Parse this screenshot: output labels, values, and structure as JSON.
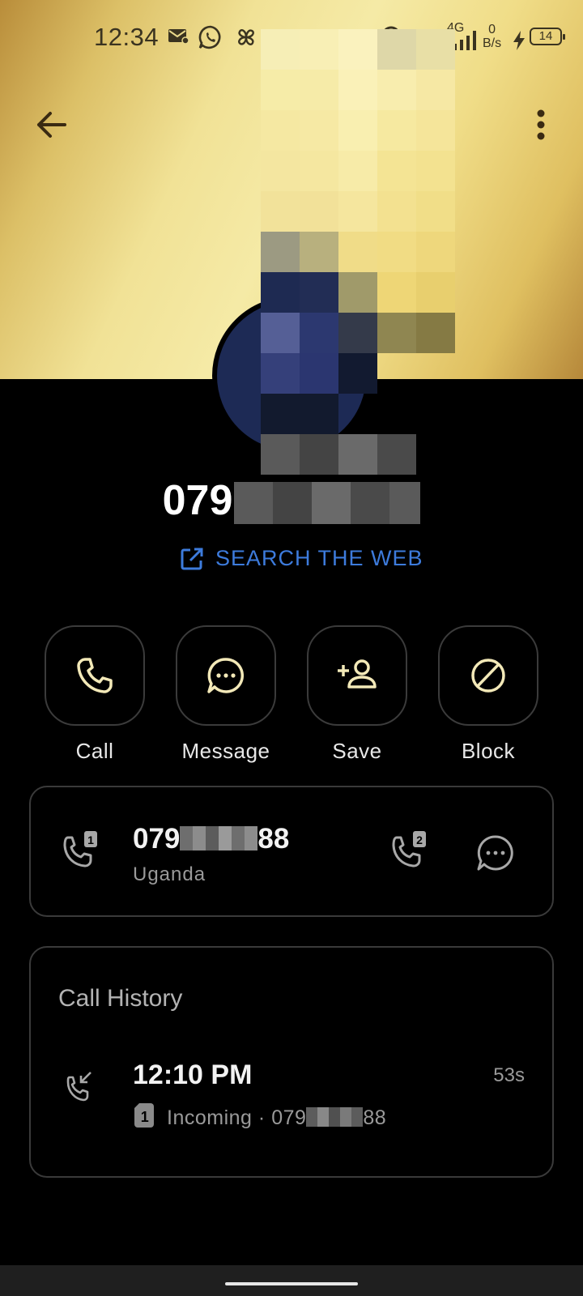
{
  "status_bar": {
    "time": "12:34",
    "network_type": "4G",
    "speed_value": "0",
    "speed_unit": "B/s",
    "battery_level": "14",
    "icons": [
      "email-notification-icon",
      "whatsapp-icon",
      "pinwheel-icon",
      "signal-icon",
      "charging-icon",
      "battery-icon"
    ]
  },
  "header": {
    "back_icon": "arrow-left-icon",
    "more_icon": "more-vertical-icon"
  },
  "contact": {
    "number_prefix": "079",
    "search_web_label": "SEARCH THE WEB"
  },
  "actions": [
    {
      "label": "Call",
      "icon": "phone-icon"
    },
    {
      "label": "Message",
      "icon": "chat-bubble-icon"
    },
    {
      "label": "Save",
      "icon": "add-contact-icon"
    },
    {
      "label": "Block",
      "icon": "block-icon"
    }
  ],
  "number_card": {
    "number_prefix": "079",
    "number_suffix": "88",
    "country": "Uganda",
    "sim1_icon": "phone-sim1-icon",
    "sim2_icon": "phone-sim2-icon",
    "message_icon": "chat-bubble-icon"
  },
  "call_history": {
    "title": "Call History",
    "entries": [
      {
        "time": "12:10 PM",
        "duration": "53s",
        "type": "Incoming",
        "separator": "·",
        "number_prefix": "079",
        "number_suffix": "88",
        "icon": "incoming-call-icon",
        "sim_icon": "sim1-icon"
      }
    ]
  },
  "colors": {
    "accent_link": "#3d7bdc",
    "icon_cream": "#f3e9b8",
    "background": "#000000"
  }
}
